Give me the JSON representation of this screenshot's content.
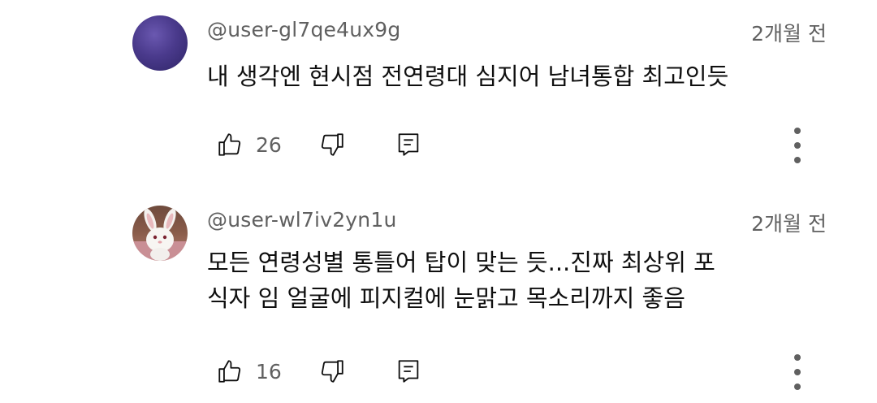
{
  "comments": [
    {
      "username": "@user-gl7qe4ux9g",
      "time": "2개월 전",
      "lines": [
        "내 생각엔 현시점 전연령대 심지어 남녀통합 최고인듯"
      ],
      "likes": "26",
      "avatar_icon": "purple-texture-avatar"
    },
    {
      "username": "@user-wl7iv2yn1u",
      "time": "2개월 전",
      "lines": [
        "모든 연령성별 통틀어 탑이 맞는 듯...진짜 최상위 포",
        "식자 임 얼굴에 피지컬에 눈맑고 목소리까지 좋음"
      ],
      "likes": "16",
      "avatar_icon": "white-bunny-avatar"
    }
  ],
  "icons": {
    "like": "thumbs-up-icon",
    "dislike": "thumbs-down-icon",
    "reply": "reply-comment-icon",
    "more": "more-vertical-icon"
  },
  "colors": {
    "secondary_text": "#606060",
    "primary_text": "#0f0f0f",
    "background": "#ffffff"
  }
}
